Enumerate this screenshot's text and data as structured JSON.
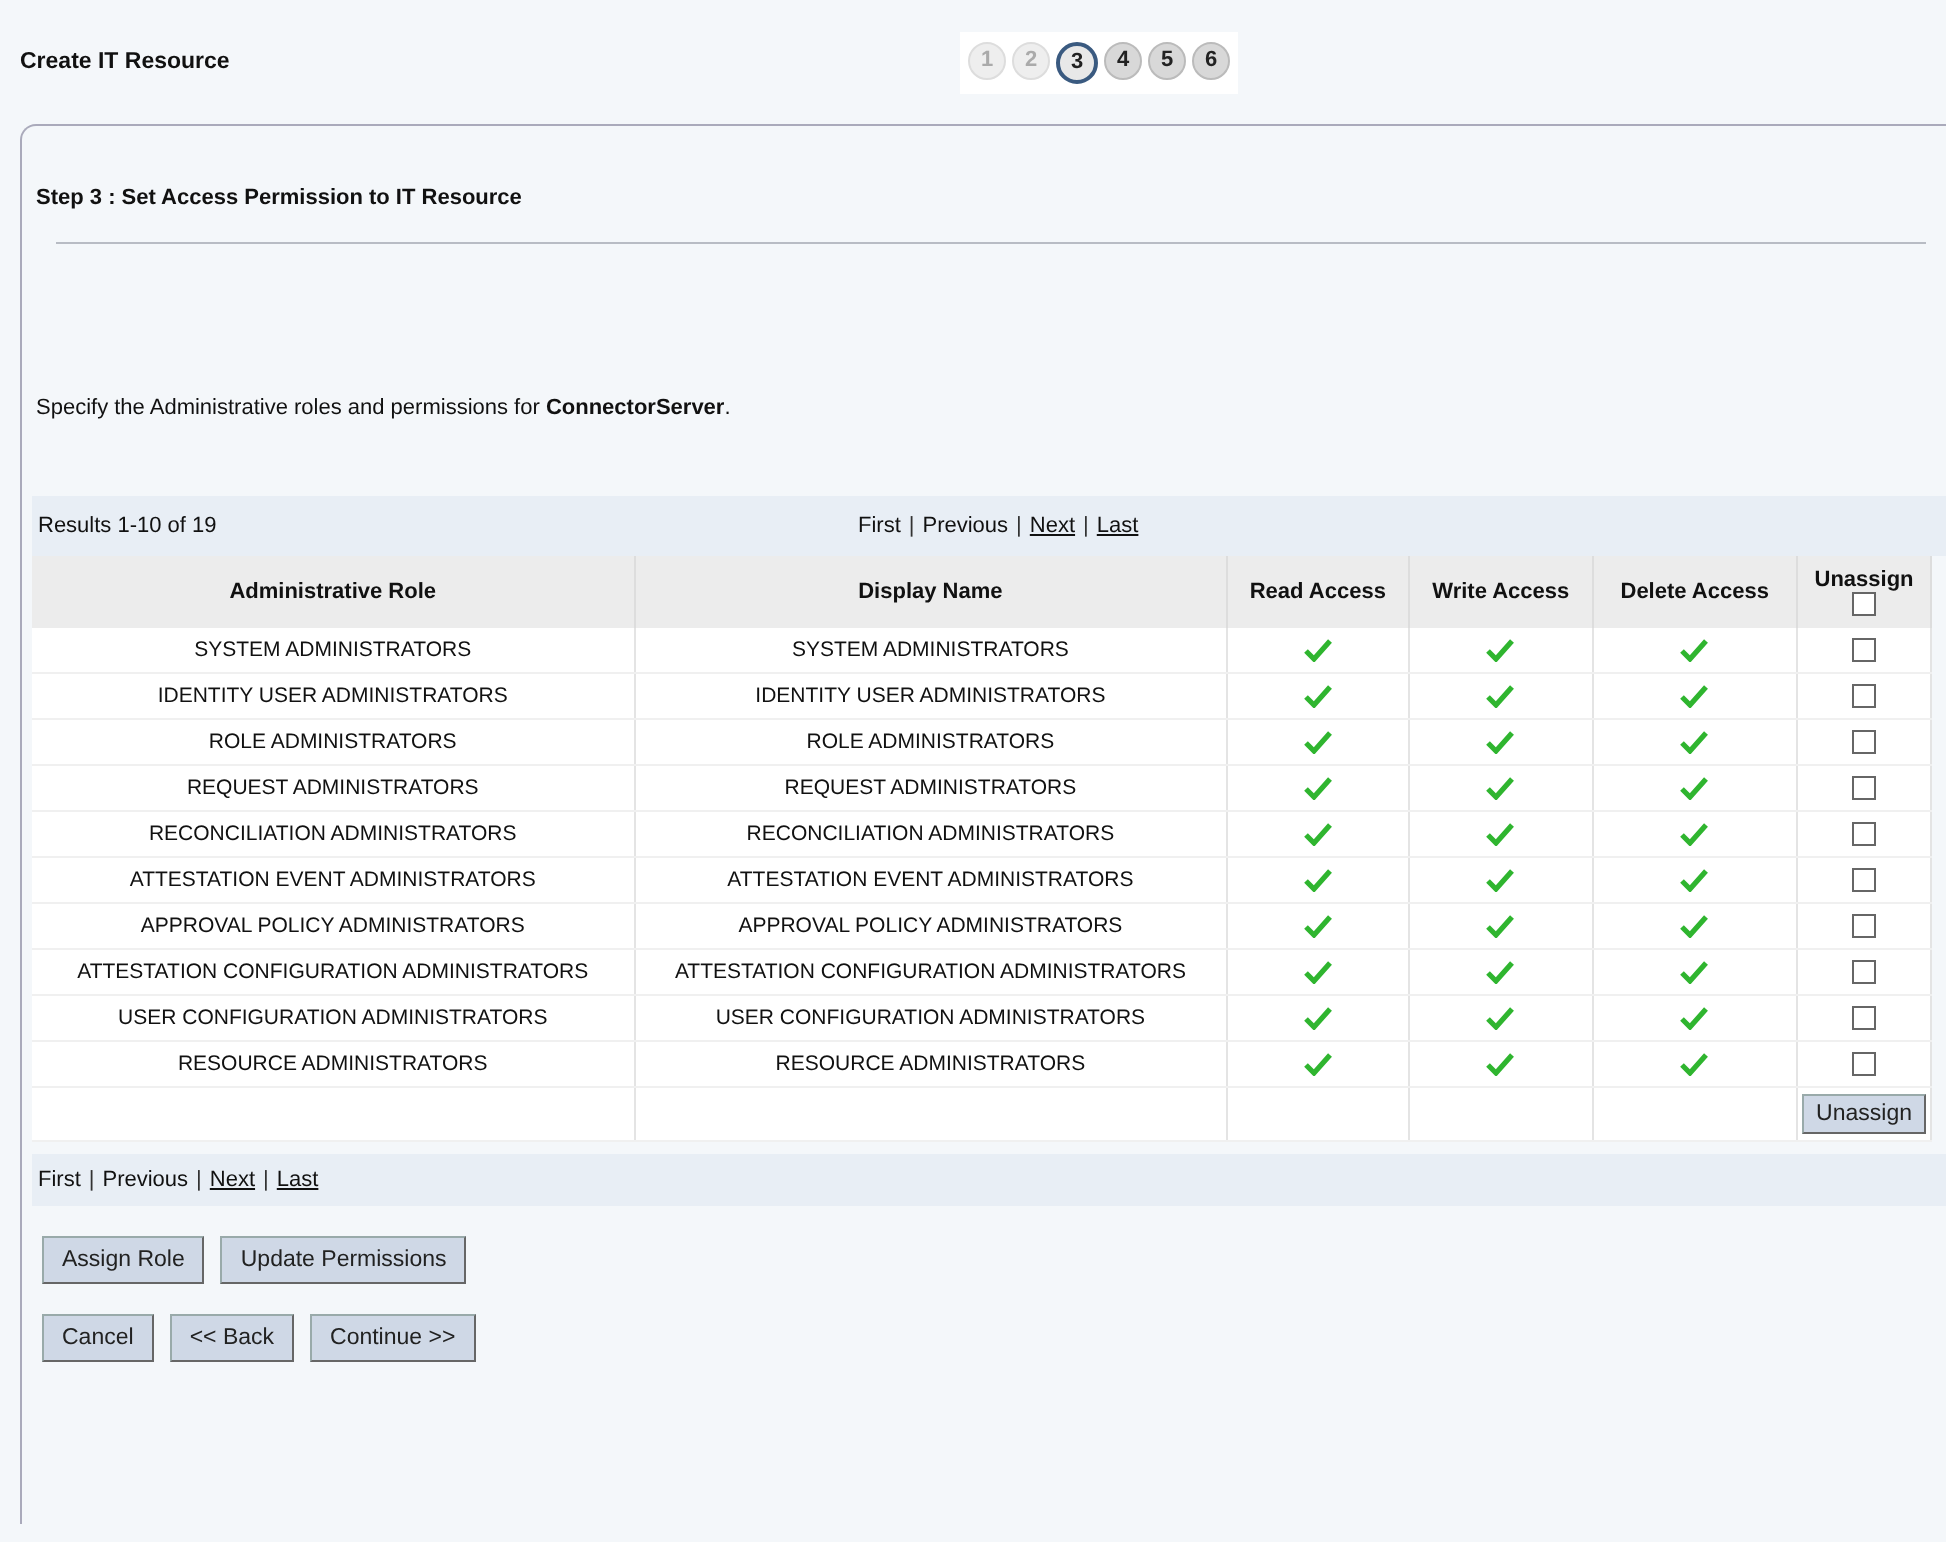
{
  "header": {
    "title": "Create IT Resource"
  },
  "steps": [
    {
      "label": "1",
      "completed": true,
      "selected": false
    },
    {
      "label": "2",
      "completed": true,
      "selected": false
    },
    {
      "label": "3",
      "completed": false,
      "selected": true
    },
    {
      "label": "4",
      "completed": false,
      "selected": false
    },
    {
      "label": "5",
      "completed": false,
      "selected": false
    },
    {
      "label": "6",
      "completed": false,
      "selected": false
    }
  ],
  "step_title": "Step 3 : Set Access Permission to IT Resource",
  "description": "Specify the Administrative roles and permissions for **ConnectorServer**.",
  "results": "Results 1-10 of 19",
  "pager_top": [
    {
      "kind": "text",
      "label": "First"
    },
    {
      "kind": "separator",
      "label": "|"
    },
    {
      "kind": "text",
      "label": "Previous"
    },
    {
      "kind": "separator",
      "label": "|"
    },
    {
      "kind": "link",
      "label": "Next"
    },
    {
      "kind": "separator",
      "label": "|"
    },
    {
      "kind": "link",
      "label": "Last"
    }
  ],
  "table": {
    "columns": [
      "Administrative Role",
      "Display Name",
      "Read Access",
      "Write Access",
      "Delete Access",
      "Unassign"
    ],
    "unassign_all": false,
    "rows": [
      {
        "role": "SYSTEM ADMINISTRATORS",
        "display": "SYSTEM ADMINISTRATORS",
        "read": true,
        "write": true,
        "delete": true,
        "unassign": false
      },
      {
        "role": "IDENTITY USER ADMINISTRATORS",
        "display": "IDENTITY USER ADMINISTRATORS",
        "read": true,
        "write": true,
        "delete": true,
        "unassign": false
      },
      {
        "role": "ROLE ADMINISTRATORS",
        "display": "ROLE ADMINISTRATORS",
        "read": true,
        "write": true,
        "delete": true,
        "unassign": false
      },
      {
        "role": "REQUEST ADMINISTRATORS",
        "display": "REQUEST ADMINISTRATORS",
        "read": true,
        "write": true,
        "delete": true,
        "unassign": false
      },
      {
        "role": "RECONCILIATION ADMINISTRATORS",
        "display": "RECONCILIATION ADMINISTRATORS",
        "read": true,
        "write": true,
        "delete": true,
        "unassign": false
      },
      {
        "role": "ATTESTATION EVENT ADMINISTRATORS",
        "display": "ATTESTATION EVENT ADMINISTRATORS",
        "read": true,
        "write": true,
        "delete": true,
        "unassign": false
      },
      {
        "role": "APPROVAL POLICY ADMINISTRATORS",
        "display": "APPROVAL POLICY ADMINISTRATORS",
        "read": true,
        "write": true,
        "delete": true,
        "unassign": false
      },
      {
        "role": "ATTESTATION CONFIGURATION ADMINISTRATORS",
        "display": "ATTESTATION CONFIGURATION ADMINISTRATORS",
        "read": true,
        "write": true,
        "delete": true,
        "unassign": false
      },
      {
        "role": "USER CONFIGURATION ADMINISTRATORS",
        "display": "USER CONFIGURATION ADMINISTRATORS",
        "read": true,
        "write": true,
        "delete": true,
        "unassign": false
      },
      {
        "role": "RESOURCE ADMINISTRATORS",
        "display": "RESOURCE ADMINISTRATORS",
        "read": true,
        "write": true,
        "delete": true,
        "unassign": false
      }
    ],
    "unassign_button": "Unassign"
  },
  "pager_bottom": [
    {
      "kind": "text",
      "label": "First"
    },
    {
      "kind": "separator",
      "label": "|"
    },
    {
      "kind": "text",
      "label": "Previous"
    },
    {
      "kind": "separator",
      "label": "|"
    },
    {
      "kind": "link",
      "label": "Next"
    },
    {
      "kind": "separator",
      "label": "|"
    },
    {
      "kind": "link",
      "label": "Last"
    }
  ],
  "action_buttons": [
    "Assign Role",
    "Update Permissions"
  ],
  "nav_buttons": [
    "Cancel",
    "<< Back",
    "Continue >>"
  ]
}
